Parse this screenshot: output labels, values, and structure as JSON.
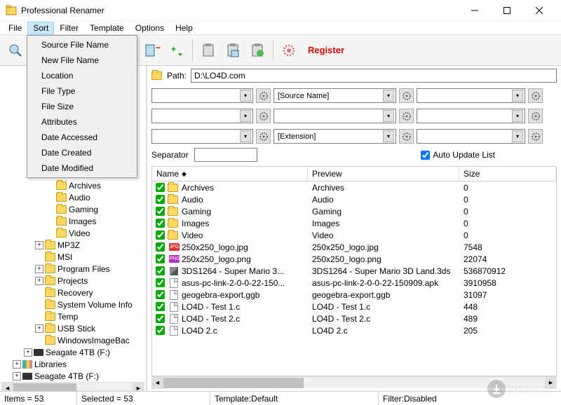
{
  "window": {
    "title": "Professional Renamer"
  },
  "menubar": [
    "File",
    "Sort",
    "Filter",
    "Template",
    "Options",
    "Help"
  ],
  "active_menu_index": 1,
  "sort_menu": [
    "Source File Name",
    "New File Name",
    "Location",
    "File Type",
    "File Size",
    "Attributes",
    "Date Accessed",
    "Date Created",
    "Date Modified"
  ],
  "toolbar": {
    "register": "Register"
  },
  "path": {
    "label": "Path:",
    "value": "D:\\LO4D.com"
  },
  "combos": {
    "row1": [
      "",
      "[Source Name]",
      ""
    ],
    "row2": [
      "",
      "",
      ""
    ],
    "row3": [
      "",
      "[Extension]",
      ""
    ]
  },
  "separator": {
    "label": "Separator",
    "value": ""
  },
  "auto_update": {
    "label": "Auto Update List",
    "checked": true
  },
  "list_headers": {
    "name": "Name",
    "preview": "Preview",
    "size": "Size"
  },
  "files": [
    {
      "chk": true,
      "type": "folder",
      "name": "Archives",
      "preview": "Archives",
      "size": "0"
    },
    {
      "chk": true,
      "type": "folder",
      "name": "Audio",
      "preview": "Audio",
      "size": "0"
    },
    {
      "chk": true,
      "type": "folder",
      "name": "Gaming",
      "preview": "Gaming",
      "size": "0"
    },
    {
      "chk": true,
      "type": "folder",
      "name": "Images",
      "preview": "Images",
      "size": "0"
    },
    {
      "chk": true,
      "type": "folder",
      "name": "Video",
      "preview": "Video",
      "size": "0"
    },
    {
      "chk": true,
      "type": "jpg",
      "name": "250x250_logo.jpg",
      "preview": "250x250_logo.jpg",
      "size": "7548"
    },
    {
      "chk": true,
      "type": "png",
      "name": "250x250_logo.png",
      "preview": "250x250_logo.png",
      "size": "22074"
    },
    {
      "chk": true,
      "type": "cube",
      "name": "3DS1264 - Super Mario 3...",
      "preview": "3DS1264 - Super Mario 3D Land.3ds",
      "size": "536870912"
    },
    {
      "chk": true,
      "type": "doc",
      "name": "asus-pc-link-2-0-0-22-150...",
      "preview": "asus-pc-link-2-0-0-22-150909.apk",
      "size": "3910958"
    },
    {
      "chk": true,
      "type": "doc",
      "name": "geogebra-export.ggb",
      "preview": "geogebra-export.ggb",
      "size": "31097"
    },
    {
      "chk": true,
      "type": "doc",
      "name": "LO4D - Test 1.c",
      "preview": "LO4D - Test 1.c",
      "size": "448"
    },
    {
      "chk": true,
      "type": "doc",
      "name": "LO4D - Test 2.c",
      "preview": "LO4D - Test 2.c",
      "size": "489"
    },
    {
      "chk": true,
      "type": "doc",
      "name": "LO4D 2.c",
      "preview": "LO4D 2.c",
      "size": "205"
    }
  ],
  "tree": [
    {
      "depth": 4,
      "exp": null,
      "icon": "folder",
      "label": "Archives"
    },
    {
      "depth": 4,
      "exp": null,
      "icon": "folder",
      "label": "Audio"
    },
    {
      "depth": 4,
      "exp": null,
      "icon": "folder",
      "label": "Gaming"
    },
    {
      "depth": 4,
      "exp": null,
      "icon": "folder",
      "label": "Images"
    },
    {
      "depth": 4,
      "exp": null,
      "icon": "folder",
      "label": "Video"
    },
    {
      "depth": 3,
      "exp": "+",
      "icon": "folder",
      "label": "MP3Z"
    },
    {
      "depth": 3,
      "exp": null,
      "icon": "folder",
      "label": "MSI"
    },
    {
      "depth": 3,
      "exp": "+",
      "icon": "folder",
      "label": "Program Files"
    },
    {
      "depth": 3,
      "exp": "+",
      "icon": "folder",
      "label": "Projects"
    },
    {
      "depth": 3,
      "exp": null,
      "icon": "folder",
      "label": "Recovery"
    },
    {
      "depth": 3,
      "exp": null,
      "icon": "folder",
      "label": "System Volume Info"
    },
    {
      "depth": 3,
      "exp": null,
      "icon": "folder",
      "label": "Temp"
    },
    {
      "depth": 3,
      "exp": "+",
      "icon": "folder",
      "label": "USB Stick"
    },
    {
      "depth": 3,
      "exp": null,
      "icon": "folder",
      "label": "WindowsImageBac"
    },
    {
      "depth": 2,
      "exp": "+",
      "icon": "drive",
      "label": "Seagate 4TB (F:)"
    },
    {
      "depth": 1,
      "exp": "+",
      "icon": "lib",
      "label": "Libraries"
    },
    {
      "depth": 1,
      "exp": "+",
      "icon": "drive",
      "label": "Seagate 4TB (F:)"
    }
  ],
  "status": {
    "items": "Items = 53",
    "selected": "Selected = 53",
    "template": "Template:Default",
    "filter": "Filter:Disabled"
  },
  "watermark": "LO4D.com"
}
